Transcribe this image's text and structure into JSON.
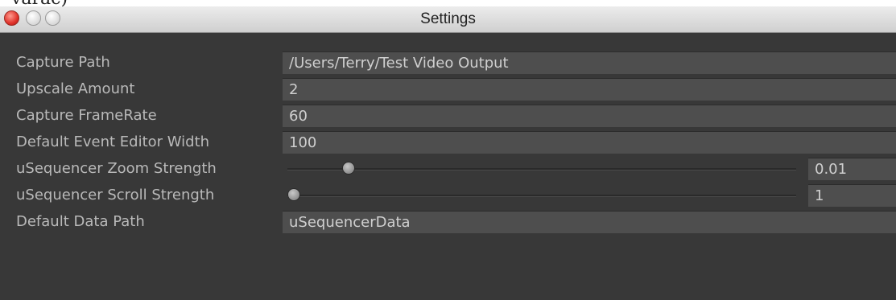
{
  "window": {
    "title": "Settings",
    "top_fragment": "varac)"
  },
  "settings": [
    {
      "label": "Capture Path",
      "value": "/Users/Terry/Test Video Output",
      "type": "text"
    },
    {
      "label": "Upscale Amount",
      "value": "2",
      "type": "text"
    },
    {
      "label": "Capture FrameRate",
      "value": "60",
      "type": "text"
    },
    {
      "label": "Default Event Editor Width",
      "value": "100",
      "type": "text"
    },
    {
      "label": "uSequencer Zoom Strength",
      "value": "0.01",
      "type": "slider",
      "level": 0.11
    },
    {
      "label": "uSequencer Scroll Strength",
      "value": "1",
      "type": "slider",
      "level": 0.0
    },
    {
      "label": "Default Data Path",
      "value": "uSequencerData",
      "type": "text"
    }
  ],
  "colors": {
    "background": "#383838",
    "field": "#4e4e4e",
    "label_text": "#b9b9b9",
    "value_text": "#cfcfcf",
    "close_button": "#e0322a"
  },
  "icons": [
    "close-icon",
    "minimize-icon",
    "zoom-icon"
  ]
}
